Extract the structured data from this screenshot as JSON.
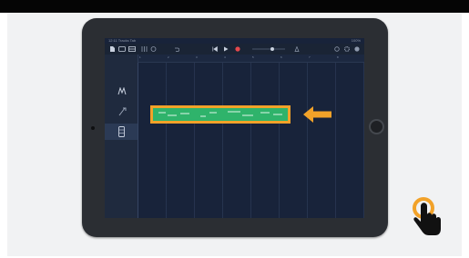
{
  "page": {
    "top_bar_color": "#050505",
    "background": "#f1f2f3"
  },
  "device": {
    "body_color": "#2b2e33"
  },
  "app": {
    "status_left": "12:11 Tracks Tab",
    "status_right": "100%",
    "toolbar": {
      "icons": [
        "my-songs-icon",
        "browser-icon",
        "tracks-view-icon",
        "mixer-icon",
        "smart-controls-icon",
        "undo-icon",
        "go-to-beginning-icon",
        "play-icon",
        "record-icon",
        "master-volume-icon",
        "metronome-icon",
        "loop-icon",
        "settings-icon",
        "help-icon"
      ],
      "record_color": "#e5484d"
    },
    "ruler_ticks": [
      "1",
      "2",
      "3",
      "4",
      "5",
      "6",
      "7",
      "8"
    ],
    "track_headers": [
      "drum-machine-icon",
      "smart-bass-icon",
      "keyboard-icon"
    ],
    "selected_track_index": 2,
    "region": {
      "color": "#2fb36b",
      "highlight_color": "#f2a229"
    },
    "arrow_color": "#f2a229",
    "add_track_label": "+"
  },
  "cursor": {
    "icon": "tap-hand-icon",
    "ring_color": "#f2a229"
  }
}
